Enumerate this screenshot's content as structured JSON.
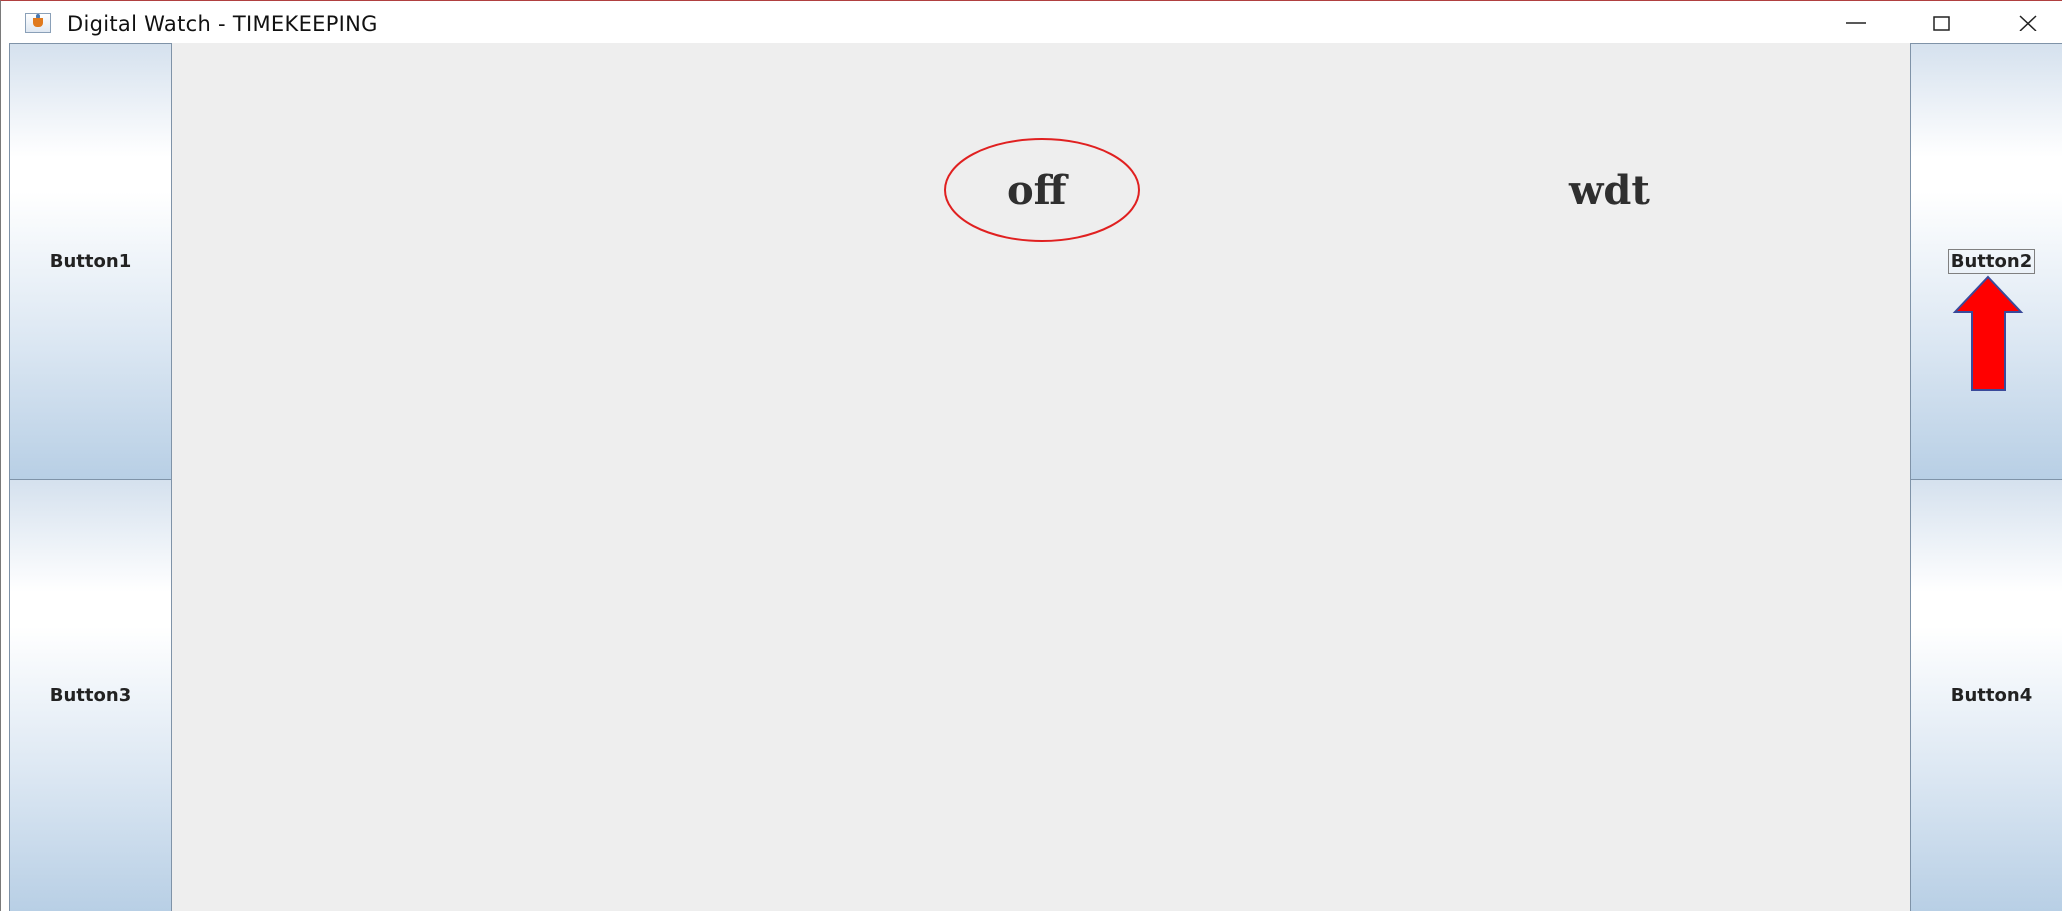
{
  "window": {
    "title": "Digital Watch - TIMEKEEPING",
    "icon": "java-cup-icon",
    "controls": [
      "minimize-icon",
      "maximize-icon",
      "close-icon"
    ]
  },
  "buttons": {
    "button1": "Button1",
    "button2": "Button2",
    "button3": "Button3",
    "button4": "Button4"
  },
  "display": {
    "mode": "off",
    "day": "wdt"
  },
  "annotations": {
    "circle_color": "#e02020",
    "arrow_fill": "#ff0000",
    "arrow_stroke": "#3a4a9a"
  }
}
